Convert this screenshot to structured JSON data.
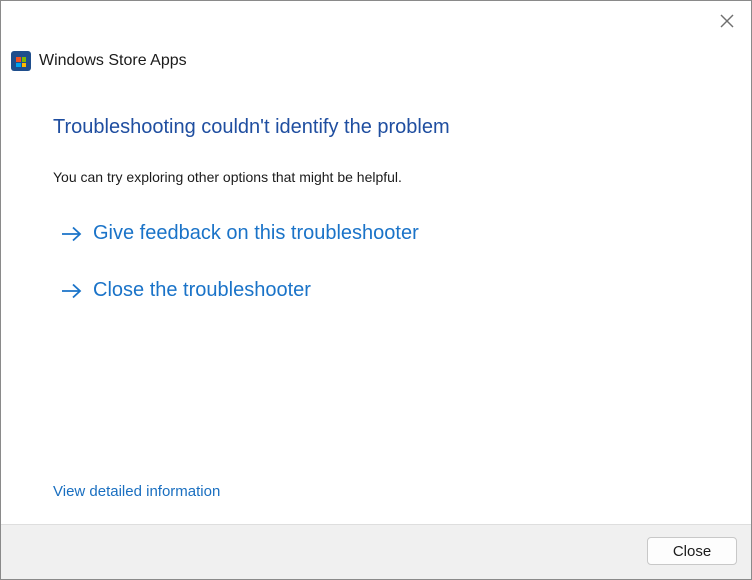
{
  "window": {
    "app_title": "Windows Store Apps",
    "close_glyph": "×"
  },
  "content": {
    "heading": "Troubleshooting couldn't identify the problem",
    "subtext": "You can try exploring other options that might be helpful.",
    "options": [
      {
        "label": "Give feedback on this troubleshooter",
        "icon": "arrow-right-icon"
      },
      {
        "label": "Close the troubleshooter",
        "icon": "arrow-right-icon"
      }
    ],
    "details_link": "View detailed information"
  },
  "footer": {
    "close_button": "Close"
  },
  "colors": {
    "heading": "#1f4ea0",
    "link": "#1a73c8",
    "footer_bg": "#f0f0f0",
    "store_icon_bg": "#1f4e8c"
  }
}
